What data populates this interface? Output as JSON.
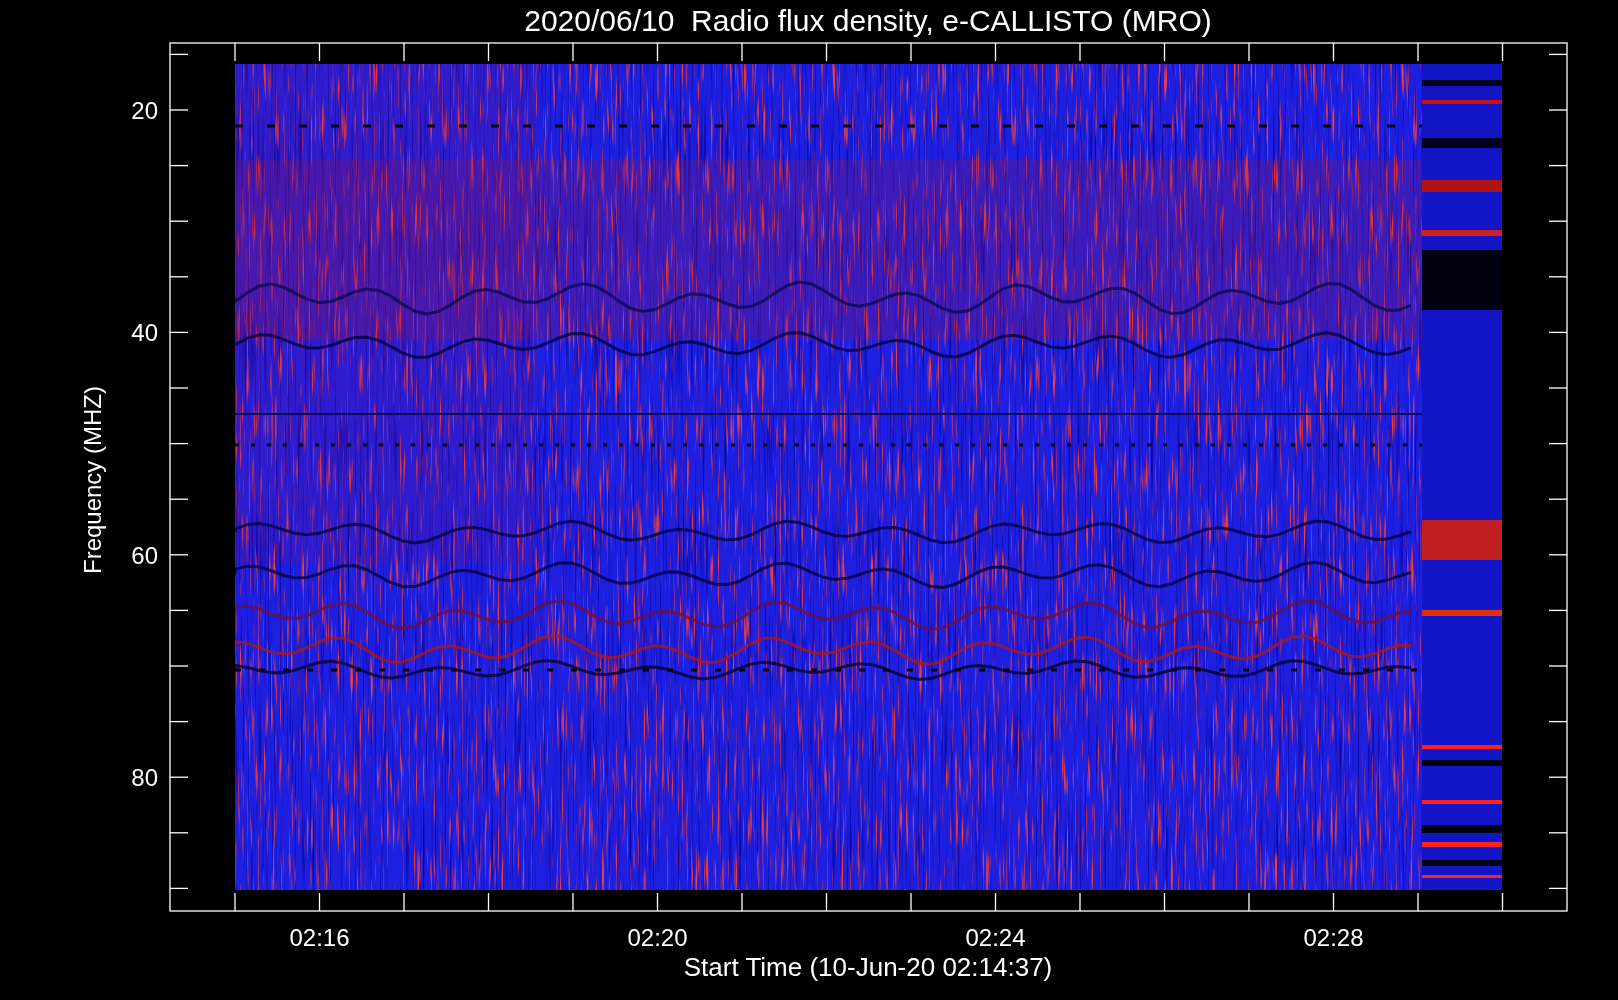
{
  "title": "2020/06/10  Radio flux density, e-CALLISTO (MRO)",
  "plot": {
    "ylabel": "Frequency (MHZ)",
    "xlabel": "Start Time (10-Jun-20 02:14:37)",
    "yticks": [
      "20",
      "40",
      "60",
      "80"
    ],
    "xticks": [
      "02:16",
      "02:20",
      "02:24",
      "02:28"
    ]
  }
}
